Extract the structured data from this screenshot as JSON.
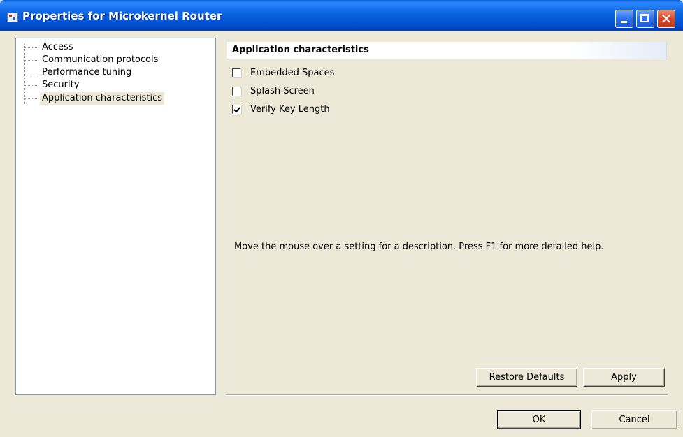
{
  "window": {
    "title": "Properties for Microkernel Router"
  },
  "tree": {
    "items": [
      {
        "label": "Access"
      },
      {
        "label": "Communication protocols"
      },
      {
        "label": "Performance tuning"
      },
      {
        "label": "Security"
      },
      {
        "label": "Application characteristics",
        "selected": true
      }
    ]
  },
  "page": {
    "header": "Application characteristics",
    "options": [
      {
        "label": "Embedded Spaces",
        "checked": false
      },
      {
        "label": "Splash Screen",
        "checked": false
      },
      {
        "label": "Verify Key Length",
        "checked": true
      }
    ],
    "help_text": "Move the mouse over a setting for a description. Press F1 for more detailed help.",
    "restore_defaults_label": "Restore Defaults",
    "apply_label": "Apply"
  },
  "dialog": {
    "ok_label": "OK",
    "cancel_label": "Cancel"
  },
  "icons": {
    "title": "app-window-icon",
    "minimize": "minimize-icon",
    "maximize": "maximize-icon",
    "close": "close-icon"
  },
  "colors": {
    "titlebar": "#0054e3",
    "dialog_bg": "#ece9d8",
    "close_button": "#d8482a"
  }
}
